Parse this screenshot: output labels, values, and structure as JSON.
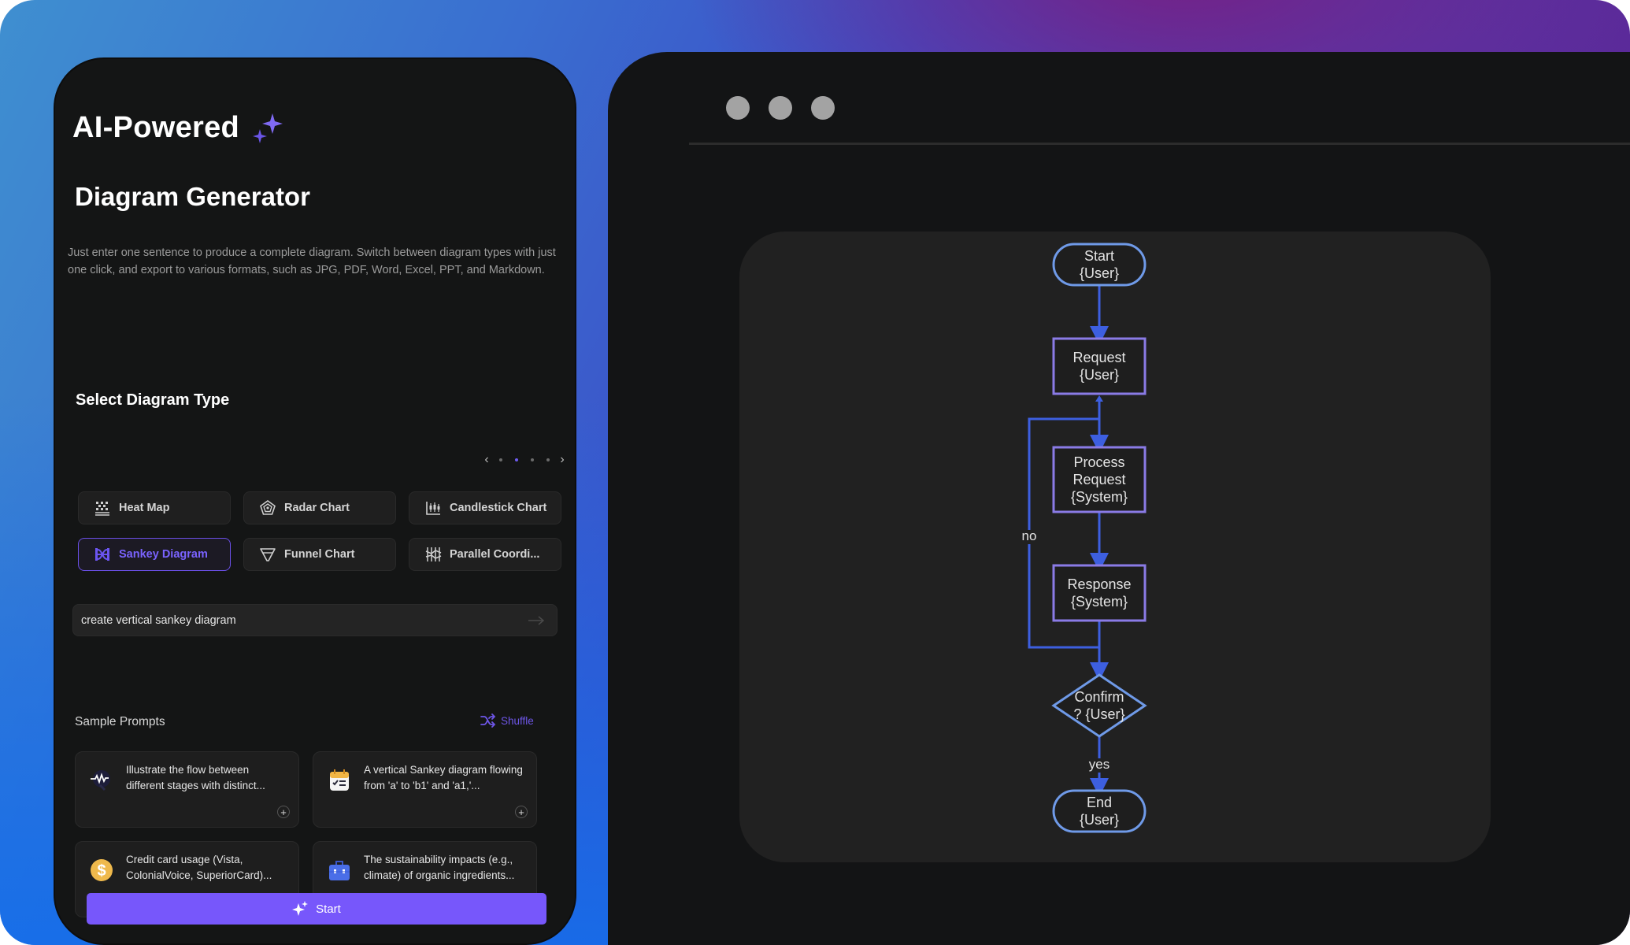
{
  "left_panel": {
    "title_line1": "AI-Powered",
    "title_line2": "Diagram Generator",
    "description": "Just enter one sentence to produce a complete diagram. Switch between diagram types with just one click, and export to various formats, such as JPG, PDF, Word, Excel, PPT, and Markdown.",
    "select_type": {
      "heading": "Select Diagram Type",
      "pager": {
        "pages": 4,
        "current": 2,
        "prev_icon": "chevron-left-icon",
        "next_icon": "chevron-right-icon"
      },
      "types": [
        {
          "label": "Heat Map",
          "icon": "heatmap-icon",
          "selected": false
        },
        {
          "label": "Radar Chart",
          "icon": "radar-chart-icon",
          "selected": false
        },
        {
          "label": "Candlestick Chart",
          "icon": "candlestick-chart-icon",
          "selected": false
        },
        {
          "label": "Sankey Diagram",
          "icon": "sankey-diagram-icon",
          "selected": true
        },
        {
          "label": "Funnel Chart",
          "icon": "funnel-chart-icon",
          "selected": false
        },
        {
          "label": "Parallel Coordi...",
          "icon": "parallel-coordinates-icon",
          "selected": false
        }
      ]
    },
    "prompt_input": {
      "value": "create vertical sankey diagram",
      "send_icon": "arrow-right-icon"
    },
    "sample_prompts": {
      "heading": "Sample Prompts",
      "shuffle_label": "Shuffle",
      "items": [
        {
          "text": "Illustrate the flow between different stages with distinct...",
          "icon": "pulse-search-icon"
        },
        {
          "text": "A vertical Sankey diagram flowing from 'a' to 'b1' and 'a1,'...",
          "icon": "checklist-calendar-icon"
        },
        {
          "text": "Credit card usage (Vista, ColonialVoice, SuperiorCard)...",
          "icon": "dollar-coin-icon"
        },
        {
          "text": "The sustainability impacts (e.g., climate) of organic ingredients...",
          "icon": "briefcase-icon"
        }
      ],
      "add_symbol": "+"
    },
    "start_label": "Start"
  },
  "preview_window": {
    "window_controls": [
      "window-dot",
      "window-dot",
      "window-dot"
    ],
    "flowchart": {
      "nodes": [
        {
          "id": "start",
          "shape": "terminal",
          "lines": [
            "Start",
            "{User}"
          ]
        },
        {
          "id": "request",
          "shape": "process",
          "lines": [
            "Request",
            "{User}"
          ]
        },
        {
          "id": "process",
          "shape": "process",
          "lines": [
            "Process",
            "Request",
            "{System}"
          ]
        },
        {
          "id": "response",
          "shape": "process",
          "lines": [
            "Response",
            "{System}"
          ]
        },
        {
          "id": "confirm",
          "shape": "decision",
          "lines": [
            "Confirm",
            "? {User}"
          ]
        },
        {
          "id": "end",
          "shape": "terminal",
          "lines": [
            "End",
            "{User}"
          ]
        }
      ],
      "edges": [
        {
          "from": "start",
          "to": "request",
          "label": ""
        },
        {
          "from": "request",
          "to": "process",
          "label": ""
        },
        {
          "from": "process",
          "to": "response",
          "label": ""
        },
        {
          "from": "response",
          "to": "confirm",
          "label": ""
        },
        {
          "from": "confirm",
          "to": "request",
          "label": "no"
        },
        {
          "from": "confirm",
          "to": "end",
          "label": "yes"
        }
      ],
      "colors": {
        "edge": "#3d5fe0",
        "terminal_stroke": "#6f9ae8",
        "process_stroke": "#8a7be6",
        "decision_stroke": "#6f9ae8",
        "node_fill": "#1e1e1e",
        "text": "#e4e4e4"
      }
    }
  },
  "colors": {
    "accent": "#7757fb",
    "panel_bg": "#141515",
    "card_bg": "#212121"
  }
}
